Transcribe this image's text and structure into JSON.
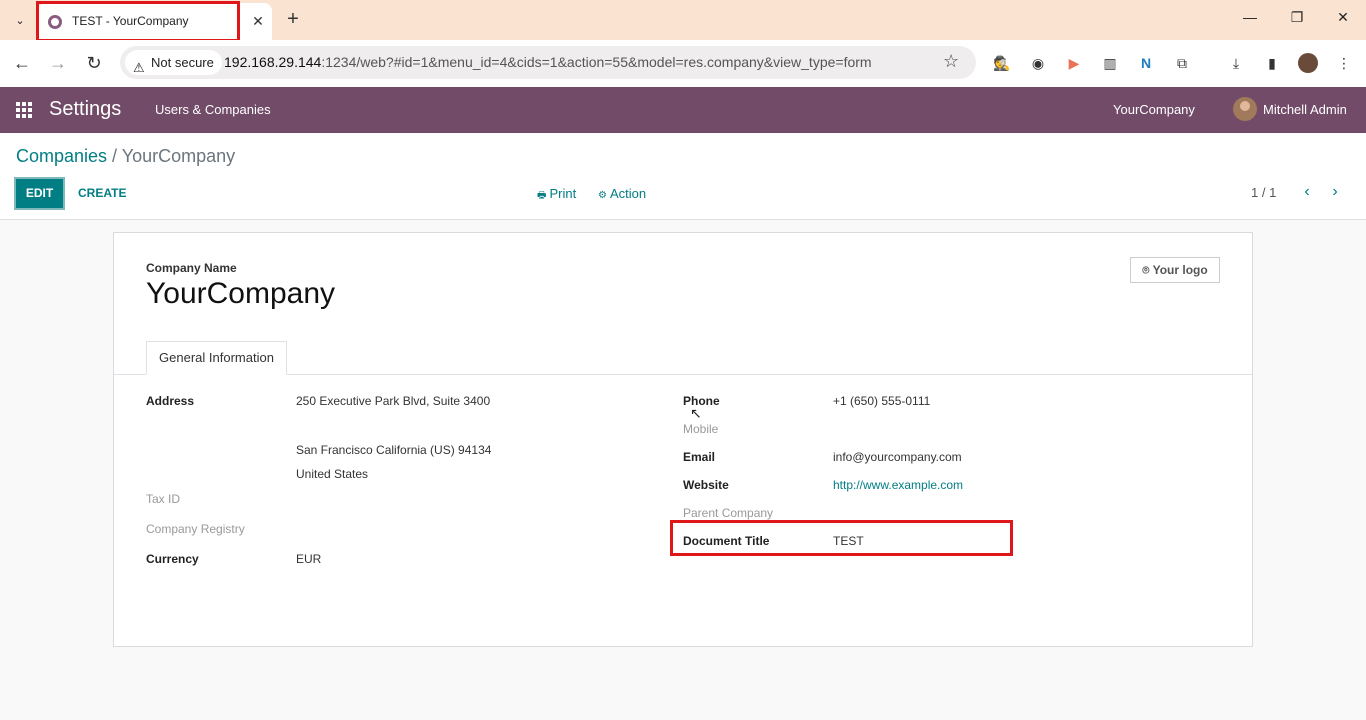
{
  "browser": {
    "tab_title": "TEST - YourCompany",
    "security_label": "Not secure",
    "url_host": "192.168.29.144",
    "url_rest": ":1234/web?#id=1&menu_id=4&cids=1&action=55&model=res.company&view_type=form"
  },
  "navbar": {
    "app_name": "Settings",
    "menu_items": [
      "Users & Companies"
    ],
    "company": "YourCompany",
    "user": "Mitchell Admin"
  },
  "control_panel": {
    "breadcrumb_parent": "Companies",
    "breadcrumb_sep": " / ",
    "breadcrumb_current": "YourCompany",
    "edit_label": "EDIT",
    "create_label": "CREATE",
    "print_label": "Print",
    "action_label": "Action",
    "pager": "1 / 1"
  },
  "form": {
    "name_caption": "Company Name",
    "company_name": "YourCompany",
    "logo_label": "Your logo",
    "tab_label": "General Information",
    "left": {
      "address_label": "Address",
      "street": "250 Executive Park Blvd, Suite 3400",
      "city_line": "San Francisco  California (US)  94134",
      "country": "United States",
      "tax_id_label": "Tax ID",
      "registry_label": "Company Registry",
      "currency_label": "Currency",
      "currency": "EUR"
    },
    "right": {
      "phone_label": "Phone",
      "phone": "+1 (650) 555-0111",
      "mobile_label": "Mobile",
      "email_label": "Email",
      "email": "info@yourcompany.com",
      "website_label": "Website",
      "website": "http://www.example.com",
      "parent_label": "Parent Company",
      "doc_title_label": "Document Title",
      "doc_title": "TEST"
    }
  },
  "colors": {
    "odoo_primary": "#714b67",
    "odoo_accent": "#017e84",
    "highlight": "#e0171a"
  }
}
